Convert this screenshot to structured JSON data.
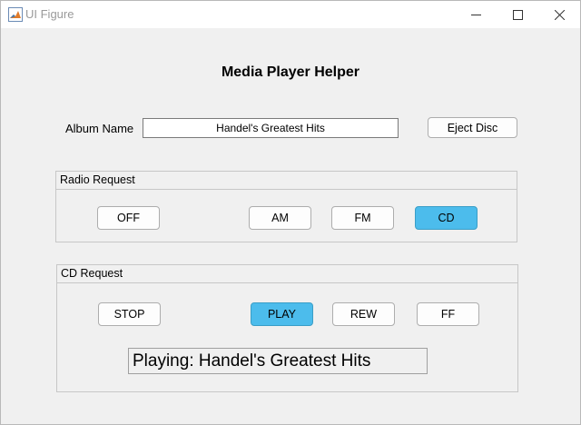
{
  "window": {
    "title": "UI Figure"
  },
  "main": {
    "title": "Media Player Helper",
    "album_label": "Album Name",
    "album_value": "Handel's Greatest Hits",
    "eject_label": "Eject Disc"
  },
  "radio_panel": {
    "title": "Radio Request",
    "buttons": [
      {
        "label": "OFF",
        "active": false
      },
      {
        "label": "AM",
        "active": false
      },
      {
        "label": "FM",
        "active": false
      },
      {
        "label": "CD",
        "active": true
      }
    ]
  },
  "cd_panel": {
    "title": "CD Request",
    "buttons": [
      {
        "label": "STOP",
        "active": false
      },
      {
        "label": "PLAY",
        "active": true
      },
      {
        "label": "REW",
        "active": false
      },
      {
        "label": "FF",
        "active": false
      }
    ],
    "status": "Playing: Handel's Greatest Hits"
  },
  "colors": {
    "active_button": "#4cbcec",
    "background": "#f0f0f0"
  }
}
